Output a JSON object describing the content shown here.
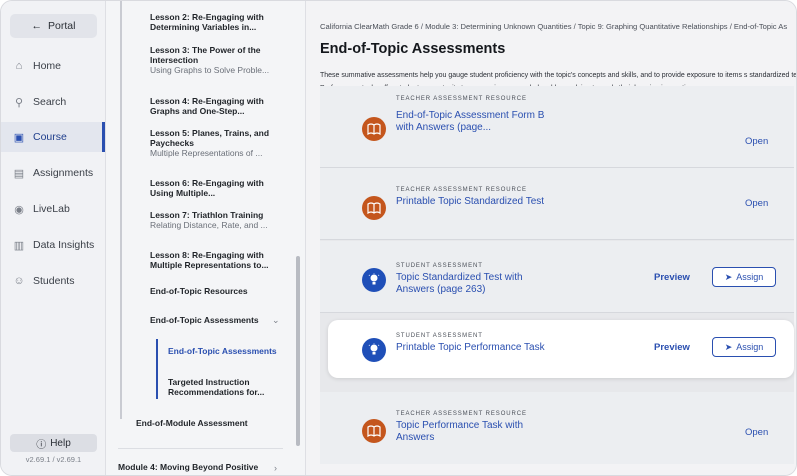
{
  "leftnav": {
    "portal_label": "Portal",
    "items": [
      {
        "label": "Home",
        "icon": "home-icon"
      },
      {
        "label": "Search",
        "icon": "search-icon"
      },
      {
        "label": "Course",
        "icon": "course-icon"
      },
      {
        "label": "Assignments",
        "icon": "assignments-icon"
      },
      {
        "label": "LiveLab",
        "icon": "livelab-icon"
      },
      {
        "label": "Data Insights",
        "icon": "data-insights-icon"
      },
      {
        "label": "Students",
        "icon": "students-icon"
      }
    ],
    "active_item": "Course",
    "help_label": "Help",
    "version": "v2.69.1 / v2.69.1"
  },
  "toc": {
    "lessons": [
      {
        "title": "Lesson 2: Re-Engaging with Determining Variables in...",
        "subtitle": ""
      },
      {
        "title": "Lesson 3: The Power of the Intersection",
        "subtitle": "Using Graphs to Solve Proble..."
      },
      {
        "title": "Lesson 4: Re-Engaging with Graphs and One-Step...",
        "subtitle": ""
      },
      {
        "title": "Lesson 5: Planes, Trains, and Paychecks",
        "subtitle": "Multiple Representations of ..."
      },
      {
        "title": "Lesson 6: Re-Engaging with Using Multiple...",
        "subtitle": ""
      },
      {
        "title": "Lesson 7: Triathlon Training",
        "subtitle": "Relating Distance, Rate, and ..."
      },
      {
        "title": "Lesson 8: Re-Engaging with Multiple Representations to...",
        "subtitle": ""
      }
    ],
    "topic_resources": "End-of-Topic Resources",
    "topic_assessments": "End-of-Topic Assessments",
    "sub_items": [
      "End-of-Topic Assessments",
      "Targeted Instruction Recommendations for..."
    ],
    "module_assessment": "End-of-Module Assessment",
    "next_module": "Module 4: Moving Beyond Positive"
  },
  "main": {
    "breadcrumb": "California ClearMath Grade 6  /  Module 3: Determining Unknown Quantities  /  Topic 9: Graphing Quantitative Relationships  /  End-of-Topic As",
    "title": "End-of-Topic Assessments",
    "description": "These summative assessments help you gauge student proficiency with the topic's concepts and skills, and to provide exposure to items s standardized tests. Performance tasks offer students opportunity to engage in open-ended problem-solving to apply their learning in creati",
    "rows": [
      {
        "kicker": "TEACHER ASSESSMENT RESOURCE",
        "title": "End-of-Topic Assessment Form B with Answers (page...",
        "action": "Open"
      },
      {
        "kicker": "TEACHER ASSESSMENT RESOURCE",
        "title": "Printable Topic Standardized Test",
        "action": "Open"
      },
      {
        "kicker": "STUDENT ASSESSMENT",
        "title": "Topic Standardized Test with Answers (page 263)",
        "preview": "Preview",
        "assign": "Assign"
      },
      {
        "kicker": "STUDENT ASSESSMENT",
        "title": "Printable Topic Performance Task",
        "preview": "Preview",
        "assign": "Assign"
      },
      {
        "kicker": "TEACHER ASSESSMENT RESOURCE",
        "title": "Topic Performance Task with Answers",
        "action": "Open"
      }
    ]
  },
  "colors": {
    "accent": "#2a4fb0",
    "teacher_icon": "#c4561d",
    "student_icon": "#1f4fb8"
  }
}
